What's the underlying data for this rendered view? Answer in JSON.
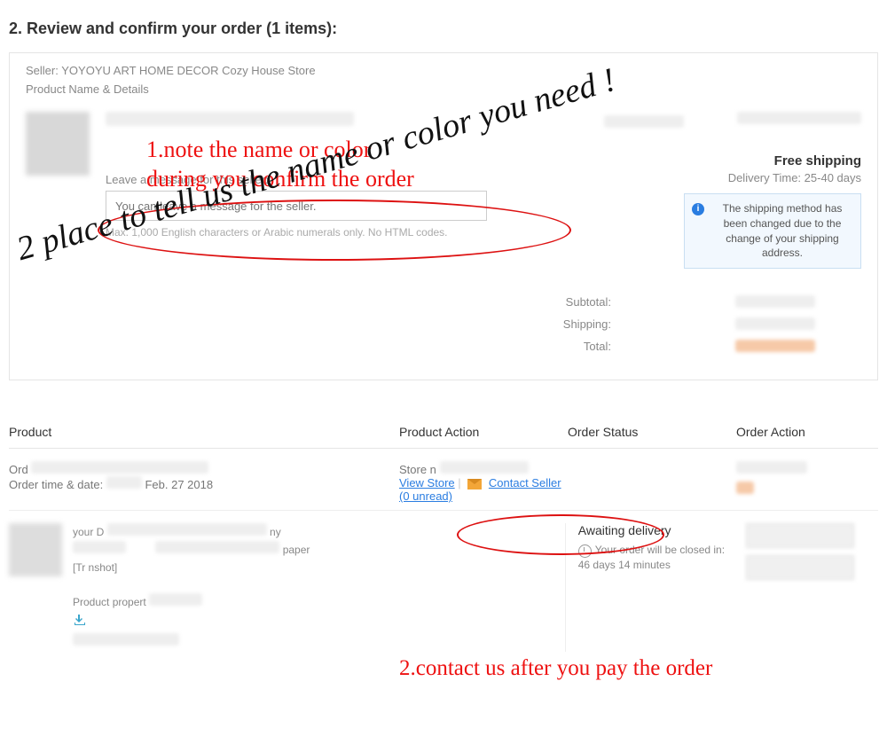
{
  "heading": "2. Review and confirm your order (1 items):",
  "seller_label": "Seller:",
  "seller_name": "YOYOYU ART HOME DECOR Cozy House Store",
  "product_name_details": "Product Name & Details",
  "leave_msg_label": "Leave a message for this seller:",
  "msg_placeholder": "You can leave a message for the seller.",
  "msg_hint": "Max. 1,000 English characters or Arabic numerals only. No HTML codes.",
  "shipping": {
    "free": "Free shipping",
    "delivery_label": "Delivery Time:",
    "delivery_value": "25-40 days",
    "notice": "The shipping method has been changed due to the change of your shipping address."
  },
  "totals": {
    "subtotal": "Subtotal:",
    "shipping": "Shipping:",
    "total": "Total:"
  },
  "annotations": {
    "note1_line1": "1.note the name or color",
    "note1_line2": "during you confirm the order",
    "handwriting": "2 place to tell us the name or color you need !",
    "note2": "2.contact us after you pay the order"
  },
  "table": {
    "headers": {
      "product": "Product",
      "product_action": "Product Action",
      "order_status": "Order Status",
      "order_action": "Order Action"
    },
    "row": {
      "ord_label": "Ord",
      "order_time_label": "Order time & date:",
      "order_time_value": "Feb. 27 2018",
      "store_label": "Store n",
      "view_store": "View Store",
      "contact_seller": "Contact Seller",
      "unread": "(0 unread)",
      "product_prop": "Product propert",
      "your": "your D",
      "paper": "paper",
      "snapshot": "[Tr                         nshot]",
      "ny": "ny",
      "awaiting": "Awaiting delivery",
      "closed_label": "Your order will be closed in:",
      "closed_value": "46 days 14 minutes"
    }
  }
}
